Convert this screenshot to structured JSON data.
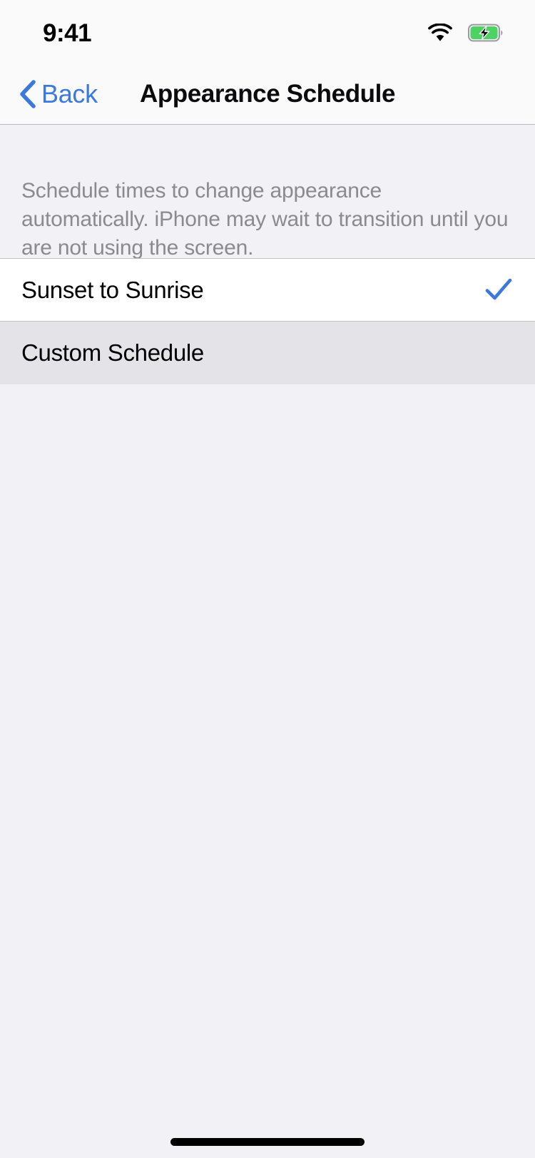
{
  "status_bar": {
    "time": "9:41",
    "wifi_icon": "wifi-icon",
    "battery_icon": "battery-charging-icon",
    "battery_color": "#4cd364"
  },
  "nav_bar": {
    "back_label": "Back",
    "back_icon": "chevron-left-icon",
    "title": "Appearance Schedule",
    "accent_color": "#3b79df"
  },
  "section": {
    "description": "Schedule times to change appearance automatically. iPhone may wait to transition until you are not using the screen."
  },
  "options": [
    {
      "label": "Sunset to Sunrise",
      "selected": true,
      "pressed": false,
      "checkmark_icon": "checkmark-icon"
    },
    {
      "label": "Custom Schedule",
      "selected": false,
      "pressed": true,
      "checkmark_icon": "checkmark-icon"
    }
  ],
  "home_indicator": {
    "label": "home-indicator"
  },
  "colors": {
    "background": "#f1f1f6",
    "row_background": "#ffffff",
    "row_pressed": "#e3e3e8",
    "separator": "#c3c3c7",
    "description_text": "#8a8a8f",
    "accent_blue": "#3b79df"
  }
}
